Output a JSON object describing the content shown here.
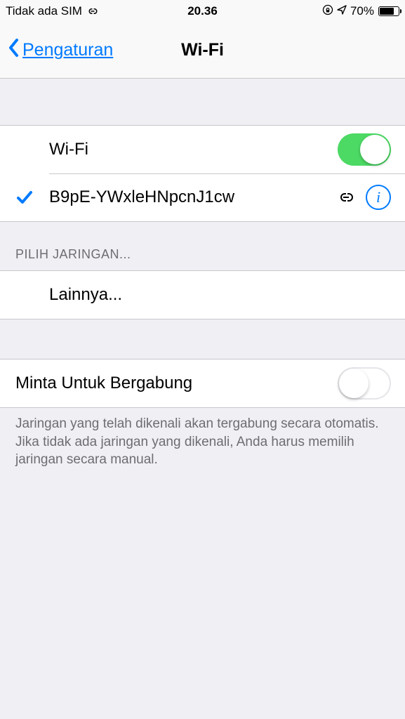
{
  "status_bar": {
    "carrier": "Tidak ada SIM",
    "time": "20.36",
    "battery_percent": "70%"
  },
  "nav": {
    "back_label": "Pengaturan",
    "title": "Wi-Fi"
  },
  "wifi": {
    "toggle_label": "Wi-Fi",
    "toggle_on": true,
    "connected_ssid": "B9pE-YWxleHNpcnJ1cw"
  },
  "networks": {
    "header": "PILIH JARINGAN...",
    "other_label": "Lainnya..."
  },
  "ask_join": {
    "label": "Minta Untuk Bergabung",
    "toggle_on": false,
    "footer": "Jaringan yang telah dikenali akan tergabung secara otomatis. Jika tidak ada jaringan yang dikenali, Anda harus memilih jaringan secara manual."
  }
}
